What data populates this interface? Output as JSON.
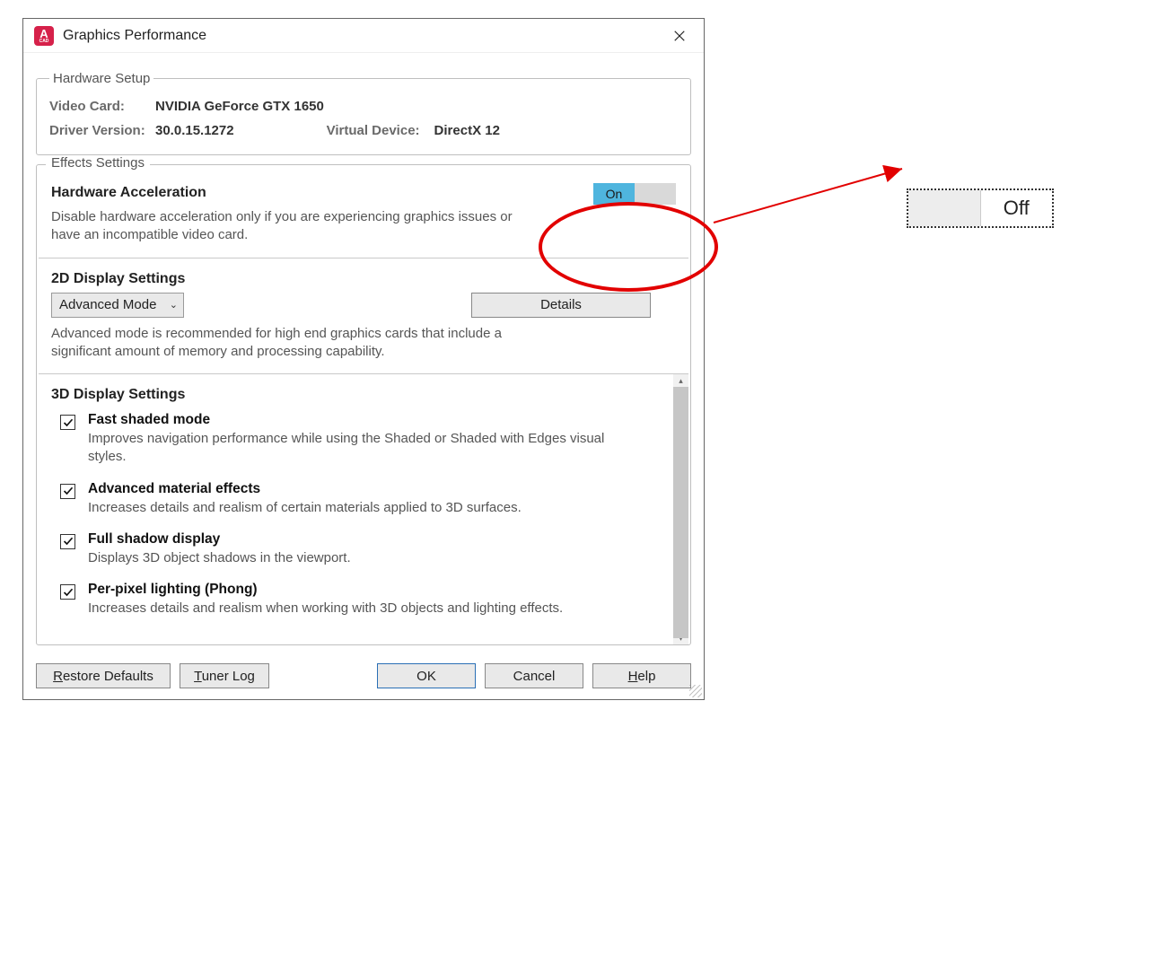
{
  "dialog": {
    "title": "Graphics Performance"
  },
  "hardware_setup": {
    "legend": "Hardware Setup",
    "video_card_label": "Video Card:",
    "video_card_value": "NVIDIA GeForce GTX 1650",
    "driver_version_label": "Driver Version:",
    "driver_version_value": "30.0.15.1272",
    "virtual_device_label": "Virtual Device:",
    "virtual_device_value": "DirectX 12"
  },
  "effects": {
    "legend": "Effects Settings",
    "hw_accel": {
      "title": "Hardware Acceleration",
      "toggle_on_label": "On",
      "desc": "Disable hardware acceleration only if you are experiencing graphics issues or have an incompatible video card."
    },
    "d2d": {
      "title": "2D Display Settings",
      "mode": "Advanced Mode",
      "details_btn": "Details",
      "desc": "Advanced mode is recommended for high end graphics cards that include a significant amount of memory and processing capability."
    },
    "d3d": {
      "title": "3D Display Settings",
      "items": [
        {
          "title": "Fast shaded mode",
          "desc": "Improves navigation performance while using the Shaded or Shaded with Edges visual styles.",
          "checked": true
        },
        {
          "title": "Advanced material effects",
          "desc": "Increases details and realism of certain materials applied to 3D surfaces.",
          "checked": true
        },
        {
          "title": "Full shadow display",
          "desc": "Displays 3D object shadows in the viewport.",
          "checked": true
        },
        {
          "title": "Per-pixel lighting (Phong)",
          "desc": "Increases details and realism when working with 3D objects and lighting effects.",
          "checked": true
        }
      ]
    }
  },
  "buttons": {
    "restore_defaults": "Restore Defaults",
    "tuner_log": "Tuner Log",
    "ok": "OK",
    "cancel": "Cancel",
    "help": "Help"
  },
  "annotation": {
    "off_label": "Off"
  }
}
